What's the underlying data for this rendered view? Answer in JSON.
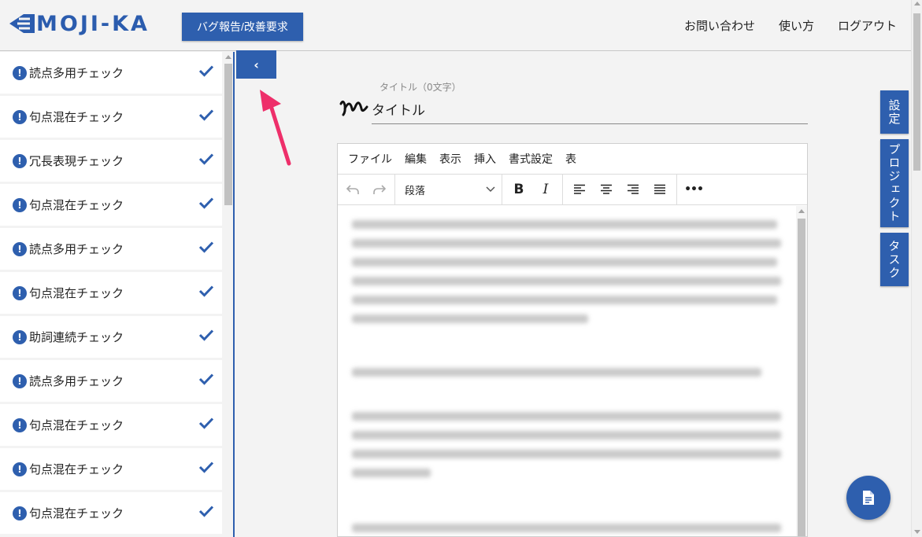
{
  "header": {
    "logo_text": "MOJI-KA",
    "bug_button": "バグ報告/改善要求",
    "nav": [
      "お問い合わせ",
      "使い方",
      "ログアウト"
    ]
  },
  "sidebar": {
    "items": [
      {
        "label": "読点多用チェック"
      },
      {
        "label": "句点混在チェック"
      },
      {
        "label": "冗長表現チェック"
      },
      {
        "label": "句点混在チェック"
      },
      {
        "label": "読点多用チェック"
      },
      {
        "label": "句点混在チェック"
      },
      {
        "label": "助詞連続チェック"
      },
      {
        "label": "読点多用チェック"
      },
      {
        "label": "句点混在チェック"
      },
      {
        "label": "句点混在チェック"
      },
      {
        "label": "句点混在チェック"
      }
    ],
    "warn_glyph": "!",
    "accent_color": "#2e5fae"
  },
  "collapse_button": "‹",
  "title": {
    "count_label": "タイトル（0文字）",
    "placeholder": "タイトル"
  },
  "editor": {
    "menu": [
      "ファイル",
      "編集",
      "表示",
      "挿入",
      "書式設定",
      "表"
    ],
    "paragraph_select": "段落",
    "bold": "B",
    "italic": "I",
    "more": "•••"
  },
  "right_tabs": [
    "設定",
    "プロジェクト",
    "タスク"
  ],
  "icons": [
    "undo-icon",
    "redo-icon",
    "align-left-icon",
    "align-center-icon",
    "align-right-icon",
    "align-justify-icon",
    "document-icon",
    "check-icon"
  ]
}
